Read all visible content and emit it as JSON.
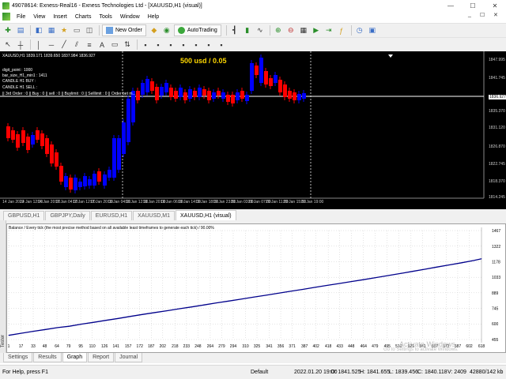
{
  "window": {
    "title": "49078614: Exness-Real16 - Exness Technologies Ltd - [XAUUSD,H1 (visual)]",
    "minimize": "—",
    "maximize": "☐",
    "close": "✕"
  },
  "menu": [
    "File",
    "View",
    "Insert",
    "Charts",
    "Tools",
    "Window",
    "Help"
  ],
  "menu_right": [
    "_",
    "☐",
    "✕"
  ],
  "toolbar": {
    "new_order": "New Order",
    "autotrading": "AutoTrading"
  },
  "chart": {
    "header": "XAUUSD,H1  1839.171 1839.650 1837.984 1836.927",
    "title": "500 usd / 0.05",
    "info_lines": [
      "digit_point : 1000",
      "bar_size_H1_min1 : 1411",
      "CANDLE H1 BUY :",
      "CANDLE H1 SELL :"
    ],
    "orders_line": "||   3rd Order : 0   ||   Buy : 0   ||   sell : 0   ||   Buylimit : 0   ||   Selllimit : 0   ||   Order bet m...",
    "current_price": "1836.927",
    "y_ticks": [
      "1847.995",
      "1841.745",
      "1836.927",
      "1835.370",
      "1831.120",
      "1826.870",
      "1822.745",
      "1818.370",
      "1814.245"
    ],
    "x_ticks": [
      "14 Jan 2022",
      "14 Jan 12:00",
      "14 Jan 20:00",
      "17 Jan 04:00",
      "17 Jan 12:00",
      "17 Jan 20:00",
      "18 Jan 04:00",
      "18 Jan 12:00",
      "18 Jan 20:00",
      "19 Jan 06:00",
      "19 Jan 14:00",
      "19 Jan 18:00",
      "19 Jan 23:00",
      "20 Jan 03:00",
      "20 Jan 07:00",
      "20 Jan 11:00",
      "20 Jan 15:00",
      "20 Jan 19:00"
    ],
    "colors": {
      "bull": "#0000ff",
      "bear": "#ff0000",
      "background": "#000000",
      "price_line": "#ffffff",
      "title": "#ffd800"
    }
  },
  "chart_tabs": [
    "GBPUSD,H1",
    "GBPJPY,Daily",
    "EURUSD,H1",
    "XAUUSD,M1",
    "XAUUSD,H1 (visual)"
  ],
  "tester": {
    "side_label": "Tester",
    "graph_label": "Balance / Every tick (the most precise method based on all available least timeframes to generate each tick) / 90.00%",
    "tabs": [
      "Settings",
      "Results",
      "Graph",
      "Report",
      "Journal"
    ],
    "active_tab": "Graph",
    "watermark": [
      "Activate Windows",
      "Go to Settings to activate Windows."
    ]
  },
  "chart_data": {
    "type": "line",
    "title": "",
    "xlabel": "",
    "ylabel": "",
    "x": [
      1,
      17,
      33,
      49,
      65,
      80,
      96,
      112,
      128,
      144,
      160,
      176,
      192,
      208,
      224,
      240,
      256,
      272,
      288,
      304,
      320,
      336,
      352,
      368,
      384,
      400,
      416,
      432,
      448,
      464,
      480,
      496,
      512,
      528,
      544,
      560,
      576,
      592,
      608,
      618
    ],
    "x_tick_labels": [
      "1",
      "17",
      "33",
      "48",
      "64",
      "79",
      "95",
      "110",
      "126",
      "141",
      "157",
      "172",
      "187",
      "202",
      "218",
      "233",
      "248",
      "264",
      "279",
      "294",
      "310",
      "325",
      "341",
      "356",
      "371",
      "387",
      "402",
      "418",
      "433",
      "448",
      "464",
      "479",
      "495",
      "510",
      "526",
      "541",
      "557",
      "572",
      "587",
      "602",
      "618"
    ],
    "y_tick_labels": [
      "1467",
      "1322",
      "1178",
      "1033",
      "889",
      "745",
      "600",
      "455"
    ],
    "ylim": [
      455,
      1467
    ],
    "series": [
      {
        "values": [
          494,
          513,
          531,
          548,
          566,
          578,
          598,
          615,
          633,
          651,
          670,
          688,
          706,
          723,
          741,
          758,
          776,
          795,
          812,
          830,
          848,
          866,
          884,
          902,
          920,
          939,
          957,
          975,
          993,
          1011,
          1030,
          1049,
          1068,
          1088,
          1108,
          1128,
          1148,
          1168,
          1189,
          1205
        ]
      }
    ],
    "color": "#00008b",
    "grid": true
  },
  "status": {
    "help": "For Help, press F1",
    "profile": "Default",
    "time": "2022.01.20 19:00",
    "open": "O: 1841.525",
    "high": "H: 1841.655",
    "low": "L: 1839.456",
    "close": "C: 1840.118",
    "volume": "V: 2409",
    "traffic": "42880/142 kb"
  }
}
